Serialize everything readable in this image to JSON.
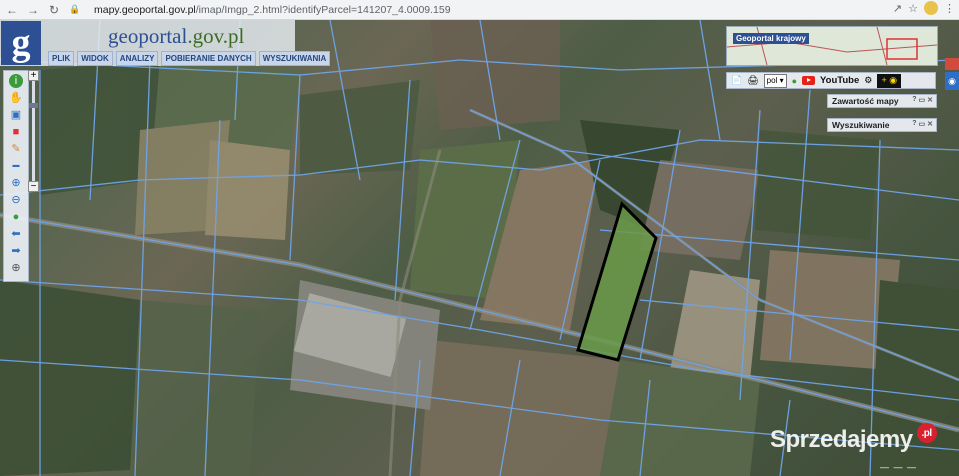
{
  "browser": {
    "url_host": "mapy.geoportal.gov.pl",
    "url_path": "/imap/Imgp_2.html?identifyParcel=141207_4.0009.159"
  },
  "header": {
    "logo_letter": "g",
    "title_main": "geoportal",
    "title_sub": ".gov.pl",
    "menu": [
      "PLIK",
      "WIDOK",
      "ANALIZY",
      "POBIERANIE DANYCH",
      "WYSZUKIWANIA"
    ]
  },
  "overview": {
    "label": "Geoportal krajowy"
  },
  "controls": {
    "language": "pol",
    "youtube": "YouTube"
  },
  "panels": [
    {
      "title": "Zawartość mapy"
    },
    {
      "title": "Wyszukiwanie"
    }
  ],
  "toolbar": {
    "icons": [
      "info-icon",
      "pan-hand-icon",
      "select-icon",
      "measure-icon",
      "pencil-icon",
      "scale-icon",
      "zoom-in-icon",
      "zoom-out-icon",
      "globe-icon",
      "back-arrow-icon",
      "forward-arrow-icon",
      "crosshair-icon"
    ]
  },
  "watermark": {
    "text": "Sprzedajemy",
    "suffix": ".pl"
  },
  "colors": {
    "brand": "#2d4f93",
    "parcel_line": "#6fa4e8",
    "highlight_fill": "#6a9a48",
    "highlight_stroke": "#000000"
  }
}
